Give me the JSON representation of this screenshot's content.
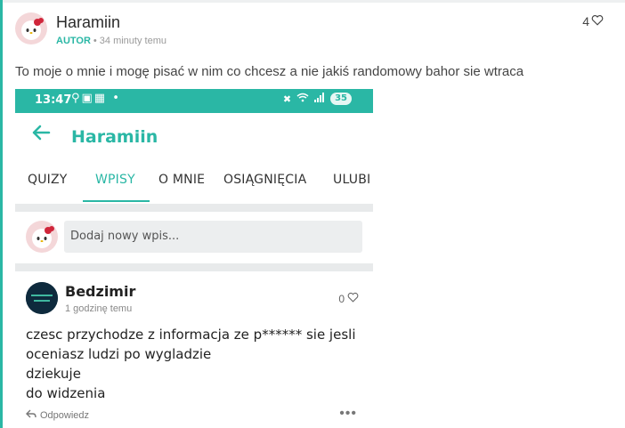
{
  "comment": {
    "author": "Haramiin",
    "badge": "AUTOR",
    "time": "34 minuty temu",
    "likes": "4",
    "text": "To moje o mnie i mogę pisać w nim co chcesz a nie jakiś randomowy bahor sie wtraca"
  },
  "screenshot": {
    "status": {
      "time": "13:47",
      "battery": "35"
    },
    "title": "Haramiin",
    "tabs": [
      {
        "label": "QUIZY"
      },
      {
        "label": "WPISY",
        "active": true
      },
      {
        "label": "O MNIE"
      },
      {
        "label": "OSIĄGNIĘCIA"
      },
      {
        "label": "ULUBI"
      }
    ],
    "composer_placeholder": "Dodaj nowy wpis...",
    "entry": {
      "author": "Bedzimir",
      "time": "1 godzinę temu",
      "likes": "0",
      "lines": [
        "czesc przychodze z informacja ze p****** sie jesli",
        "oceniasz ludzi po wygladzie",
        "dziekuje",
        "do widzenia"
      ],
      "reply_label": "Odpowiedz"
    }
  },
  "colors": {
    "accent": "#2ab7a5",
    "separator": "#e8eaeb"
  },
  "icons": [
    "heart-icon",
    "back-arrow-icon",
    "reply-icon",
    "more-icon",
    "wifi-icon",
    "signal-icon",
    "mute-icon"
  ]
}
